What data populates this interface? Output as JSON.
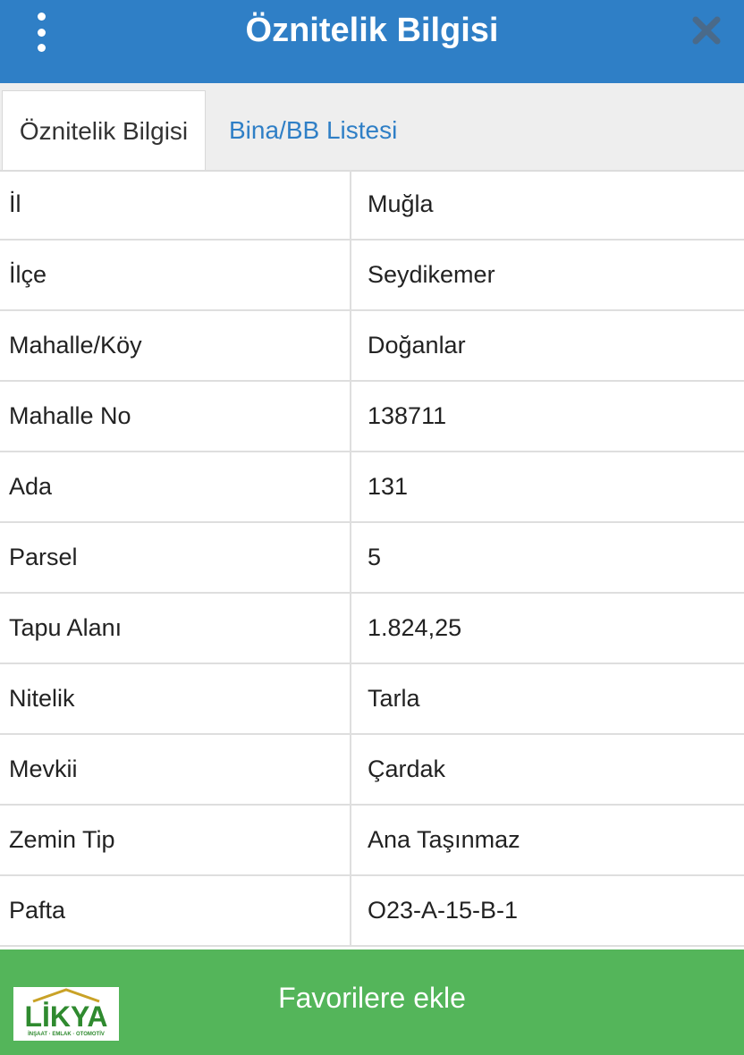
{
  "header": {
    "title": "Öznitelik Bilgisi",
    "menu_icon": "more-vertical-icon",
    "close_icon": "close-icon"
  },
  "tabs": [
    {
      "label": "Öznitelik Bilgisi",
      "active": true
    },
    {
      "label": "Bina/BB Listesi",
      "active": false
    }
  ],
  "rows": [
    {
      "key": "İl",
      "value": "Muğla"
    },
    {
      "key": "İlçe",
      "value": "Seydikemer"
    },
    {
      "key": "Mahalle/Köy",
      "value": "Doğanlar"
    },
    {
      "key": "Mahalle No",
      "value": "138711"
    },
    {
      "key": "Ada",
      "value": "131"
    },
    {
      "key": "Parsel",
      "value": "5"
    },
    {
      "key": "Tapu Alanı",
      "value": "1.824,25"
    },
    {
      "key": "Nitelik",
      "value": "Tarla"
    },
    {
      "key": "Mevkii",
      "value": "Çardak"
    },
    {
      "key": "Zemin Tip",
      "value": "Ana Taşınmaz"
    },
    {
      "key": "Pafta",
      "value": "O23-A-15-B-1"
    }
  ],
  "footer": {
    "favorite_label": "Favorilere ekle"
  },
  "logo": {
    "name": "LİKYA",
    "tagline": "İNŞAAT · EMLAK · OTOMOTİV"
  },
  "colors": {
    "header": "#2f7fc6",
    "footer": "#54b55a",
    "tab_link": "#2f7fc6"
  }
}
